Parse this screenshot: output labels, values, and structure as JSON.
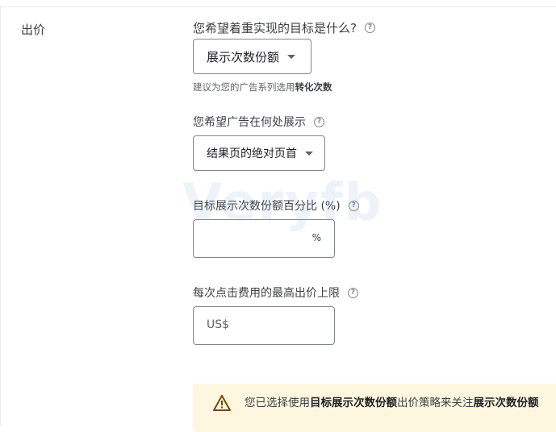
{
  "section": {
    "label": "出价"
  },
  "goal": {
    "question": "您希望着重实现的目标是什么?",
    "selected": "展示次数份额",
    "hint_prefix": "建议为您的广告系列选用",
    "hint_bold": "转化次数"
  },
  "location": {
    "question": "您希望广告在何处展示",
    "selected": "结果页的绝对页首"
  },
  "target_share": {
    "label": "目标展示次数份额百分比 (%)",
    "suffix": "%",
    "value": ""
  },
  "max_cpc": {
    "label": "每次点击费用的最高出价上限",
    "prefix": "US$"
  },
  "watermark": "Veryfb",
  "alert": {
    "text_1": "您已选择使用",
    "bold_1": "目标展示次数份额",
    "text_2": "出价策略来关注",
    "bold_2": "展示次数份额"
  }
}
